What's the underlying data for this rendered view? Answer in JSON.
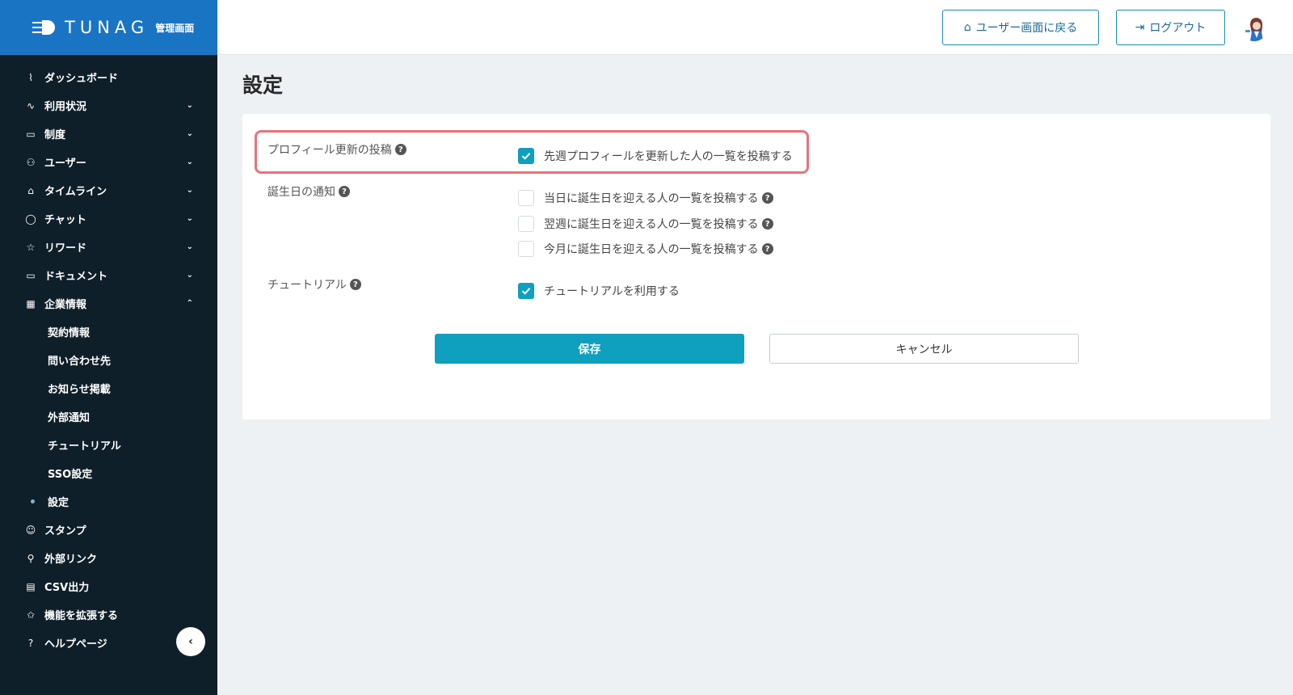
{
  "brand": {
    "name": "TUNAG",
    "sub": "管理画面",
    "color": "#1a74c4"
  },
  "sidebar": {
    "items": [
      {
        "label": "ダッシュボード",
        "icon": "chart-line-icon",
        "glyph": "⌇",
        "chevron": ""
      },
      {
        "label": "利用状況",
        "icon": "pulse-icon",
        "glyph": "∿",
        "chevron": "⌄"
      },
      {
        "label": "制度",
        "icon": "book-icon",
        "glyph": "▭",
        "chevron": "⌄"
      },
      {
        "label": "ユーザー",
        "icon": "users-icon",
        "glyph": "⚇",
        "chevron": "⌄"
      },
      {
        "label": "タイムライン",
        "icon": "home-icon",
        "glyph": "⌂",
        "chevron": "⌄"
      },
      {
        "label": "チャット",
        "icon": "chat-icon",
        "glyph": "◯",
        "chevron": "⌄"
      },
      {
        "label": "リワード",
        "icon": "star-icon",
        "glyph": "☆",
        "chevron": "⌄"
      },
      {
        "label": "ドキュメント",
        "icon": "folder-icon",
        "glyph": "▭",
        "chevron": "⌄"
      },
      {
        "label": "企業情報",
        "icon": "building-icon",
        "glyph": "▦",
        "chevron": "⌃"
      }
    ],
    "sub_items": [
      {
        "label": "契約情報",
        "active": false
      },
      {
        "label": "問い合わせ先",
        "active": false
      },
      {
        "label": "お知らせ掲載",
        "active": false
      },
      {
        "label": "外部通知",
        "active": false
      },
      {
        "label": "チュートリアル",
        "active": false
      },
      {
        "label": "SSO設定",
        "active": false
      },
      {
        "label": "設定",
        "active": true
      }
    ],
    "bottom_items": [
      {
        "label": "スタンプ",
        "icon": "smile-icon",
        "glyph": "☺"
      },
      {
        "label": "外部リンク",
        "icon": "link-icon",
        "glyph": "⚲"
      },
      {
        "label": "CSV出力",
        "icon": "table-icon",
        "glyph": "▤"
      },
      {
        "label": "機能を拡張する",
        "icon": "sparkle-star-icon",
        "glyph": "✩"
      },
      {
        "label": "ヘルプページ",
        "icon": "help-bulb-icon",
        "glyph": "?"
      }
    ],
    "collapse_glyph": "‹"
  },
  "header": {
    "user_screen_label": "ユーザー画面に戻る",
    "logout_label": "ログアウト"
  },
  "page": {
    "title": "設定"
  },
  "settings": {
    "profile": {
      "label": "プロフィール更新の投稿",
      "options": [
        {
          "label": "先週プロフィールを更新した人の一覧を投稿する",
          "checked": true
        }
      ]
    },
    "birthday": {
      "label": "誕生日の通知",
      "options": [
        {
          "label": "当日に誕生日を迎える人の一覧を投稿する",
          "checked": false
        },
        {
          "label": "翌週に誕生日を迎える人の一覧を投稿する",
          "checked": false
        },
        {
          "label": "今月に誕生日を迎える人の一覧を投稿する",
          "checked": false
        }
      ]
    },
    "tutorial": {
      "label": "チュートリアル",
      "options": [
        {
          "label": "チュートリアルを利用する",
          "checked": true
        }
      ]
    }
  },
  "actions": {
    "save_label": "保存",
    "cancel_label": "キャンセル"
  },
  "colors": {
    "accent": "#0f9fbf",
    "highlight": "#e8737a",
    "sidebar_bg": "#0f1f2a"
  }
}
